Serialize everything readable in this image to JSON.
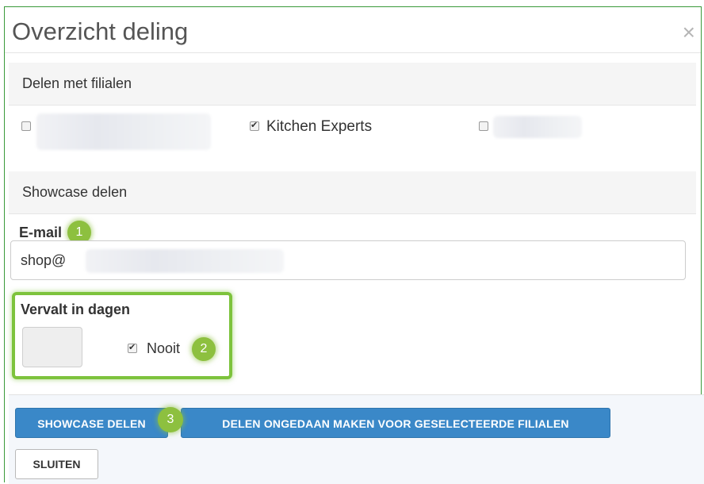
{
  "modal": {
    "title": "Overzicht deling",
    "close_symbol": "×"
  },
  "share_branches": {
    "title": "Delen met filialen",
    "branches": [
      {
        "label": "",
        "checked": false,
        "redacted": true
      },
      {
        "label": "Kitchen Experts",
        "checked": true,
        "redacted": false
      },
      {
        "label": "",
        "checked": false,
        "redacted": true
      }
    ]
  },
  "showcase": {
    "title": "Showcase delen",
    "email_label": "E-mail",
    "email_value": "shop@",
    "expires_label": "Vervalt in dagen",
    "days_value": "",
    "never_label": "Nooit",
    "never_checked": true
  },
  "markers": [
    "1",
    "2",
    "3"
  ],
  "buttons": {
    "share_showcase": "SHOWCASE DELEN",
    "unshare_selected": "DELEN ONGEDAAN MAKEN VOOR GESELECTEERDE FILIALEN",
    "close": "SLUITEN"
  },
  "colors": {
    "primary": "#3a88c8",
    "annotation_green": "#8dc03f",
    "frame_border": "#3a9a3a"
  },
  "icons": {
    "close": "close-icon",
    "checkbox": "checkbox-icon"
  }
}
